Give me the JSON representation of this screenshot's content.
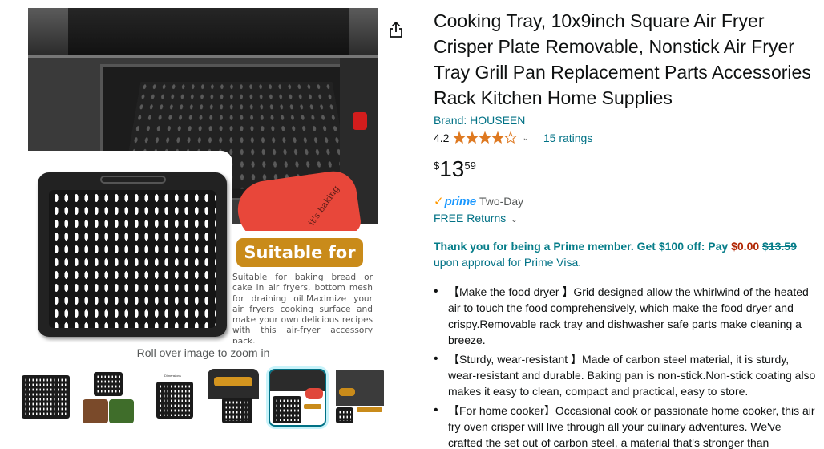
{
  "gallery": {
    "badge_text": "Suitable for",
    "description": "Suitable for baking bread or cake in air fryers, bottom mesh for draining oil.Maximize your air fryers cooking surface and make your own delicious recipes with this air-fryer accessory pack.",
    "mitt_text": "it's baking",
    "zoom_hint": "Roll over image to zoom in",
    "thumb_label": "Dimensions"
  },
  "share": {
    "icon": "share-icon"
  },
  "product": {
    "title": "Cooking Tray, 10x9inch Square Air Fryer Crisper Plate Removable, Nonstick Air Fryer Tray Grill Pan Replacement Parts Accessories Rack Kitchen Home Supplies",
    "brand": "Brand: HOUSEEN",
    "rating": "4.2",
    "rating_stars": 4.2,
    "ratings_count": "15 ratings",
    "price": {
      "currency": "$",
      "whole": "13",
      "fraction": "59"
    },
    "prime": {
      "check": "✓",
      "word": "prime",
      "delivery": "Two-Day"
    },
    "returns": "FREE Returns",
    "promo": {
      "lead": "Thank you for being a Prime member. Get $100 off: Pay ",
      "pay_amount": "$0.00",
      "original": "$13.59",
      "tail": "upon approval for Prime Visa."
    },
    "bullets": [
      "【Make the food dryer 】Grid designed allow the whirlwind of the heated air to touch the food comprehensively, which make the food dryer and crispy.Removable rack tray and dishwasher safe parts make cleaning a breeze.",
      "【Sturdy, wear-resistant 】Made of carbon steel material, it is sturdy, wear-resistant and durable. Baking pan is non-stick.Non-stick coating also makes it easy to clean, compact and practical, easy to store.",
      "【For home cooker】Occasional cook or passionate home cooker, this air fry oven crisper will live through all your culinary adventures. We've crafted the set out of carbon steel, a material that's stronger than"
    ]
  },
  "colors": {
    "link": "#007185",
    "prime_blue": "#1a98ff",
    "star": "#de7921",
    "price_red": "#b12704",
    "badge": "#c98b1a",
    "selected_thumb": "#007185"
  }
}
